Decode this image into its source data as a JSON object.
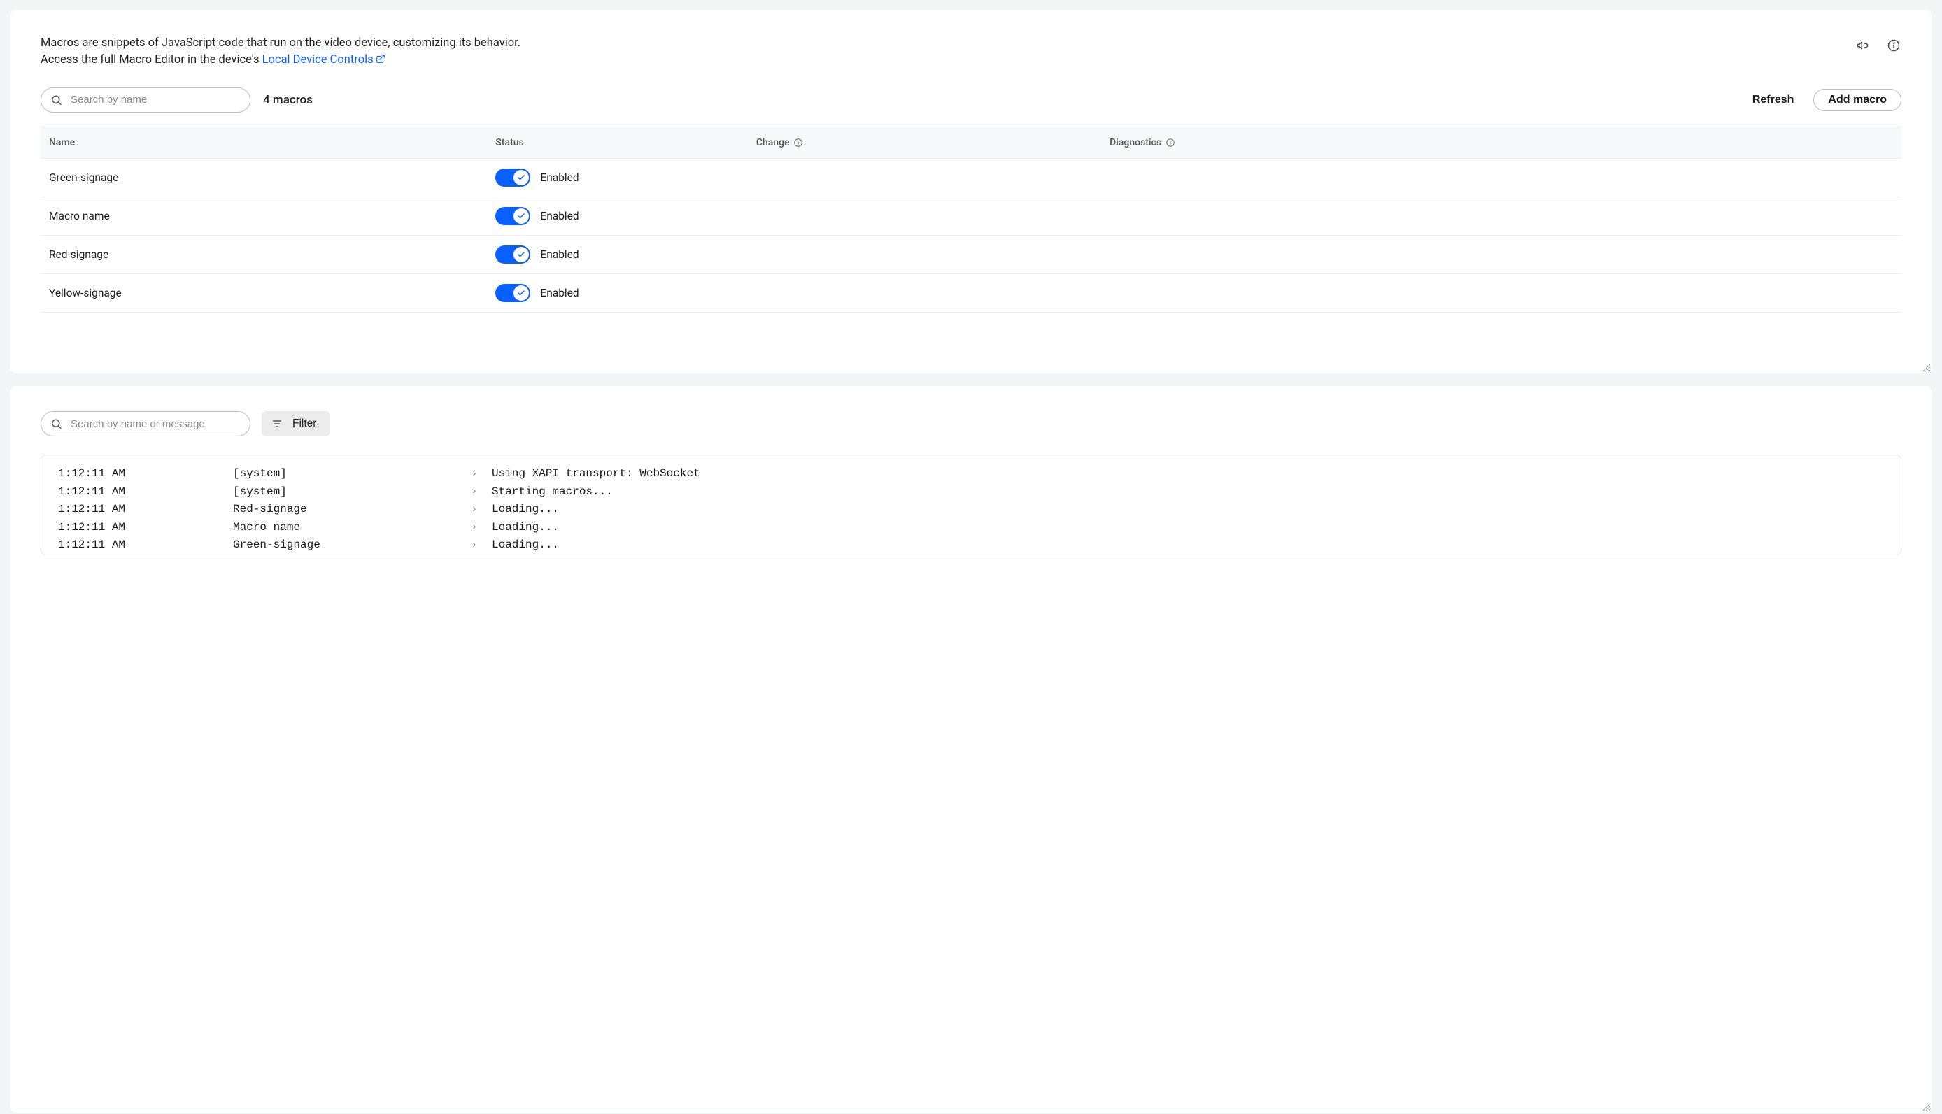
{
  "intro": {
    "line1": "Macros are snippets of JavaScript code that run on the video device, customizing its behavior.",
    "line2_prefix": "Access the full Macro Editor in the device's ",
    "link_text": "Local Device Controls"
  },
  "search": {
    "placeholder_top": "Search by name",
    "placeholder_bottom": "Search by name or message"
  },
  "count_label": "4 macros",
  "buttons": {
    "refresh": "Refresh",
    "add_macro": "Add macro",
    "filter": "Filter"
  },
  "table": {
    "headers": {
      "name": "Name",
      "status": "Status",
      "change": "Change",
      "diagnostics": "Diagnostics"
    },
    "rows": [
      {
        "name": "Green-signage",
        "status": "Enabled",
        "enabled": true
      },
      {
        "name": "Macro name",
        "status": "Enabled",
        "enabled": true
      },
      {
        "name": "Red-signage",
        "status": "Enabled",
        "enabled": true
      },
      {
        "name": "Yellow-signage",
        "status": "Enabled",
        "enabled": true
      }
    ]
  },
  "logs": [
    {
      "time": "1:12:11 AM",
      "source": "[system]",
      "message": "Using XAPI transport: WebSocket"
    },
    {
      "time": "1:12:11 AM",
      "source": "[system]",
      "message": "Starting macros..."
    },
    {
      "time": "1:12:11 AM",
      "source": "Red-signage",
      "message": "Loading..."
    },
    {
      "time": "1:12:11 AM",
      "source": "Macro name",
      "message": "Loading..."
    },
    {
      "time": "1:12:11 AM",
      "source": "Green-signage",
      "message": "Loading..."
    }
  ]
}
